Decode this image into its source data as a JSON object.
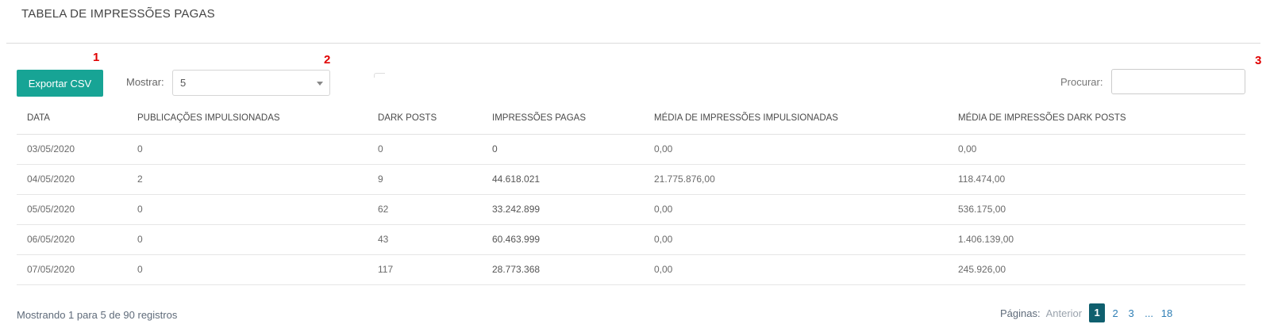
{
  "panel": {
    "title": "TABELA DE IMPRESSÕES PAGAS"
  },
  "markers": [
    "1",
    "2",
    "3"
  ],
  "toolbar": {
    "export_label": "Exportar CSV",
    "show_label": "Mostrar:",
    "show_value": "5",
    "search_label": "Procurar:",
    "search_value": "",
    "accent_color": "#17a495"
  },
  "table": {
    "columns": [
      "DATA",
      "PUBLICAÇÕES IMPULSIONADAS",
      "DARK POSTS",
      "IMPRESSÕES PAGAS",
      "MÉDIA DE IMPRESSÕES IMPULSIONADAS",
      "MÉDIA DE IMPRESSÕES DARK POSTS"
    ],
    "rows": [
      [
        "03/05/2020",
        "0",
        "0",
        "0",
        "0,00",
        "0,00"
      ],
      [
        "04/05/2020",
        "2",
        "9",
        "44.618.021",
        "21.775.876,00",
        "118.474,00"
      ],
      [
        "05/05/2020",
        "0",
        "62",
        "33.242.899",
        "0,00",
        "536.175,00"
      ],
      [
        "06/05/2020",
        "0",
        "43",
        "60.463.999",
        "0,00",
        "1.406.139,00"
      ],
      [
        "07/05/2020",
        "0",
        "117",
        "28.773.368",
        "0,00",
        "245.926,00"
      ]
    ]
  },
  "footer": {
    "info": "Mostrando 1 para 5 de 90 registros",
    "pages_label": "Páginas:",
    "prev_label": "Anterior",
    "pages": [
      "1",
      "2",
      "3"
    ],
    "ellipsis": "...",
    "last_page": "18",
    "active_page": "1",
    "active_color": "#0f5f6e"
  }
}
